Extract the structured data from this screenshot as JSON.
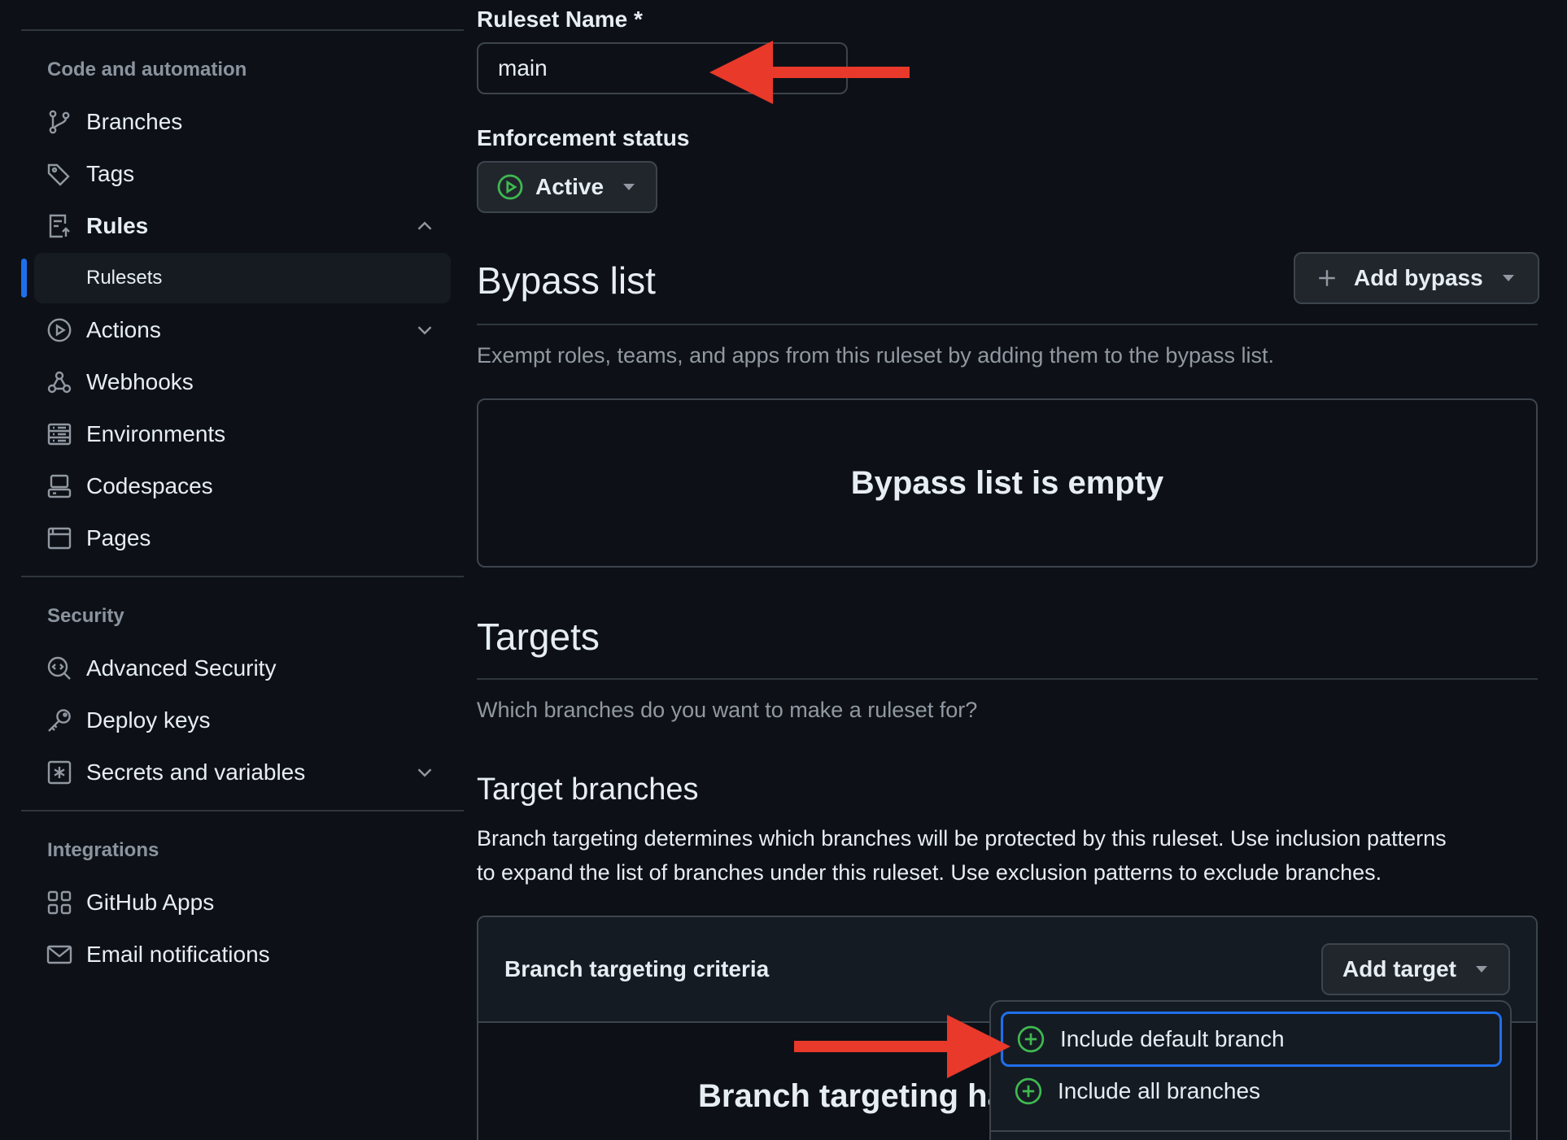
{
  "sidebar": {
    "sections": {
      "code_automation": "Code and automation",
      "security": "Security",
      "integrations": "Integrations"
    },
    "items": {
      "branches": "Branches",
      "tags": "Tags",
      "rules": "Rules",
      "rulesets": "Rulesets",
      "actions": "Actions",
      "webhooks": "Webhooks",
      "environments": "Environments",
      "codespaces": "Codespaces",
      "pages": "Pages",
      "advanced_security": "Advanced Security",
      "deploy_keys": "Deploy keys",
      "secrets": "Secrets and variables",
      "github_apps": "GitHub Apps",
      "email": "Email notifications"
    }
  },
  "form": {
    "name_label": "Ruleset Name *",
    "name_value": "main",
    "enforcement_label": "Enforcement status",
    "enforcement_value": "Active"
  },
  "bypass": {
    "title": "Bypass list",
    "add_label": "Add bypass",
    "description": "Exempt roles, teams, and apps from this ruleset by adding them to the bypass list.",
    "empty": "Bypass list is empty"
  },
  "targets": {
    "title": "Targets",
    "question": "Which branches do you want to make a ruleset for?",
    "branches_title": "Target branches",
    "branches_desc_1": "Branch targeting determines which branches will be protected by this ruleset. Use inclusion patterns",
    "branches_desc_2": "to expand the list of branches under this ruleset. Use exclusion patterns to exclude branches.",
    "criteria_label": "Branch targeting criteria",
    "add_target": "Add target",
    "partial_heading": "Branch targeting ha"
  },
  "menu": {
    "include_default": "Include default branch",
    "include_all": "Include all branches"
  },
  "colors": {
    "accent_blue": "#1f6feb",
    "success_green": "#3fb950",
    "annotation_red": "#e8392a"
  }
}
